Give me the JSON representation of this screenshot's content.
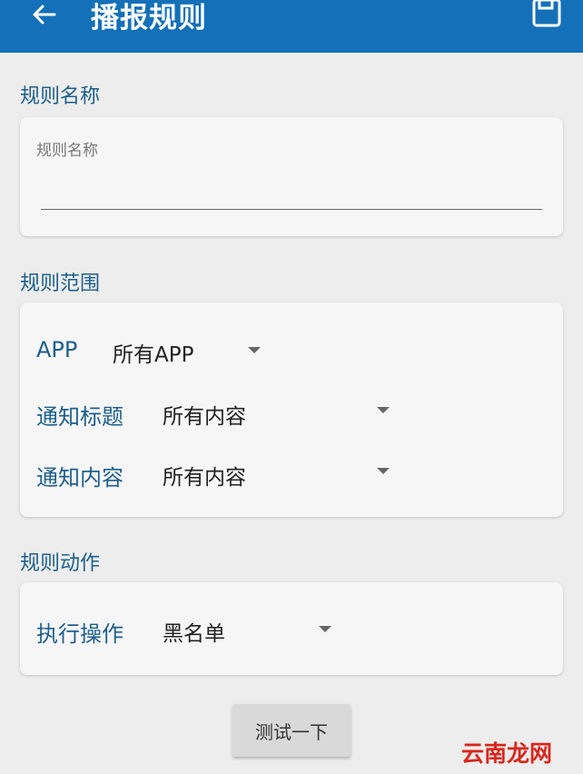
{
  "appbar": {
    "title": "播报规则",
    "back_icon": "arrow-left-icon",
    "save_icon": "save-icon"
  },
  "sections": {
    "name": {
      "label": "规则名称",
      "field_placeholder": "规则名称",
      "field_value": ""
    },
    "scope": {
      "label": "规则范围",
      "rows": [
        {
          "label": "APP",
          "value": "所有APP"
        },
        {
          "label": "通知标题",
          "value": "所有内容"
        },
        {
          "label": "通知内容",
          "value": "所有内容"
        }
      ]
    },
    "action": {
      "label": "规则动作",
      "rows": [
        {
          "label": "执行操作",
          "value": "黑名单"
        }
      ]
    }
  },
  "test_button": {
    "label": "测试一下"
  },
  "watermark": {
    "text": "云南龙网"
  },
  "colors": {
    "appbar": "#1470b8",
    "accent_text": "#1d5f8c",
    "background": "#ededed",
    "card": "#f6f6f6"
  }
}
